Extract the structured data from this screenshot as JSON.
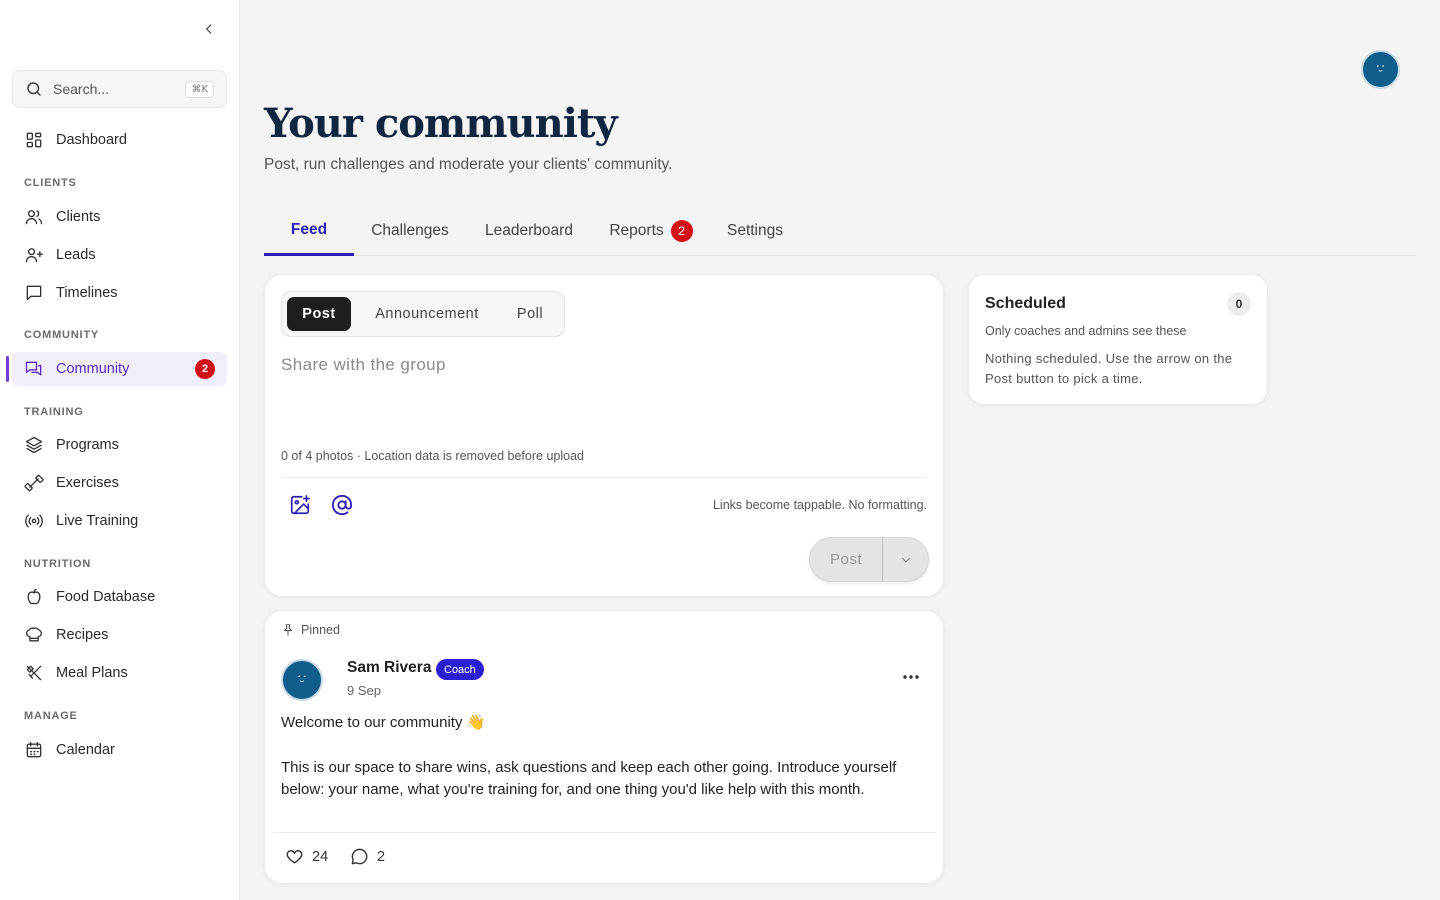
{
  "sidebar": {
    "search": {
      "placeholder": "Search...",
      "shortcut": "⌘K"
    },
    "dashboard": "Dashboard",
    "sections": {
      "clients": "CLIENTS",
      "community": "COMMUNITY",
      "training": "TRAINING",
      "nutrition": "NUTRITION",
      "manage": "MANAGE"
    },
    "items": {
      "clients": "Clients",
      "leads": "Leads",
      "timelines": "Timelines",
      "community": "Community",
      "community_badge": "2",
      "programs": "Programs",
      "exercises": "Exercises",
      "live_training": "Live Training",
      "food_database": "Food Database",
      "recipes": "Recipes",
      "meal_plans": "Meal Plans",
      "calendar": "Calendar"
    }
  },
  "header": {
    "title": "Your community",
    "subtitle": "Post, run challenges and moderate your clients' community."
  },
  "tabs": {
    "feed": "Feed",
    "challenges": "Challenges",
    "leaderboard": "Leaderboard",
    "reports": "Reports",
    "reports_badge": "2",
    "settings": "Settings"
  },
  "composer": {
    "types": {
      "post": "Post",
      "announcement": "Announcement",
      "poll": "Poll"
    },
    "placeholder": "Share with the group",
    "photo_note": "0 of 4 photos · Location data is removed before upload",
    "links_note": "Links become tappable. No formatting.",
    "post_button": "Post"
  },
  "scheduled": {
    "title": "Scheduled",
    "count": "0",
    "subtitle": "Only coaches and admins see these",
    "body": "Nothing scheduled. Use the arrow on the Post button to pick a time."
  },
  "post": {
    "pinned_label": "Pinned",
    "author": "Sam Rivera",
    "role_badge": "Coach",
    "date": "9 Sep",
    "body_line1": "Welcome to our community 👋",
    "body_line2": "This is our space to share wins, ask questions and keep each other going. Introduce yourself below: your name, what you're training for, and one thing you'd like help with this month.",
    "likes": "24",
    "comments": "2"
  },
  "colors": {
    "accent": "#2b1fb8",
    "sidebar_active": "#5b2bc4",
    "badge_red": "#d40f1a",
    "avatar": "#0f5e8c"
  }
}
